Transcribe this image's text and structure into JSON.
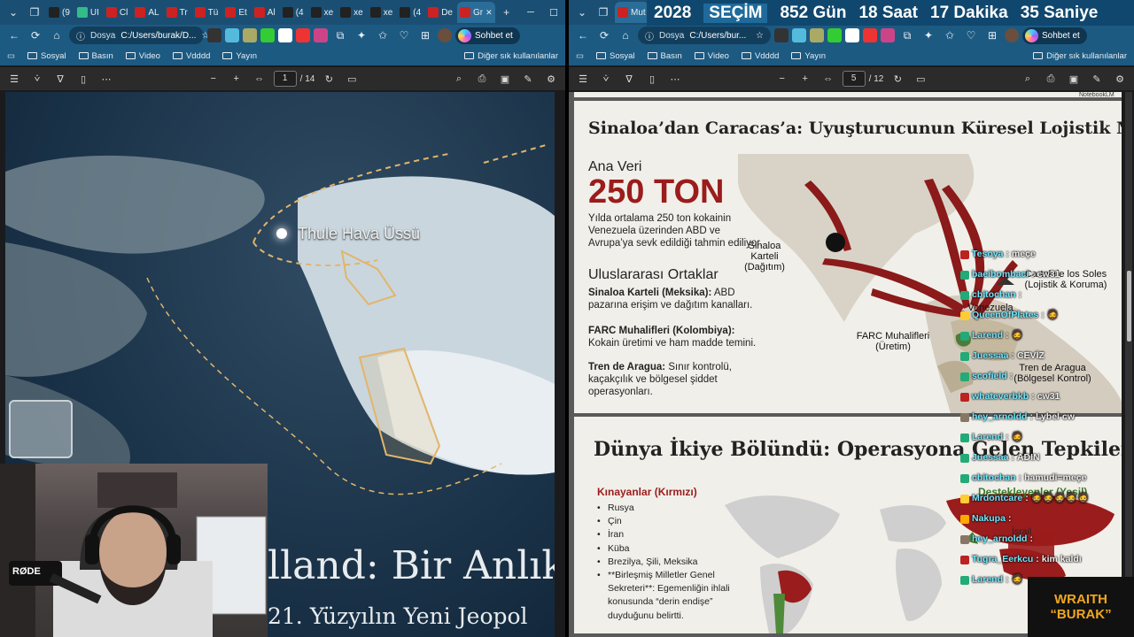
{
  "countdown": {
    "year": "2028",
    "label": "SEÇİM",
    "days": "852 Gün",
    "hours": "18 Saat",
    "minutes": "17 Dakika",
    "seconds": "35 Saniye"
  },
  "left_window": {
    "tabs": [
      "(9",
      "UI",
      "Cl",
      "AL",
      "Tr",
      "Tü",
      "Et",
      "Al",
      "(4",
      "xe",
      "xe",
      "xe",
      "(4",
      "De",
      "Gr"
    ],
    "new_tab": "+",
    "address": {
      "scheme": "Dosya",
      "path": "C:/Users/burak/D..."
    },
    "copilot_label": "Sohbet et",
    "bookmarks": [
      "Sosyal",
      "Basın",
      "Video",
      "Vdddd",
      "Yayın"
    ],
    "bookmarks_other": "Diğer sık kullanılanlar",
    "pdf": {
      "page": "1",
      "total": "/ 14"
    },
    "slide": {
      "thule_label": "Thule Hava Üssü",
      "title": "lland: Bir Anlık",
      "subtitle": "21. Yüzyılın Yeni Jeopol"
    },
    "webcam": {
      "mic_brand": "RØDE"
    }
  },
  "right_window": {
    "tabs": [
      "Mut"
    ],
    "address": {
      "scheme": "Dosya",
      "path": "C:/Users/bur..."
    },
    "copilot_label": "Sohbet et",
    "bookmarks": [
      "Sosyal",
      "Basın",
      "Video",
      "Vdddd",
      "Yayın"
    ],
    "bookmarks_other": "Diğer sık kullanılanlar",
    "pdf": {
      "page": "5",
      "total": "/ 12"
    },
    "watermark": "NotebookLM",
    "slide1": {
      "title": "Sinaloa’dan Caracas’a: Uyuşturucunun Küresel Lojistik Merkezi",
      "ana_veri": "Ana Veri",
      "ton": "250 TON",
      "desc": "Yılda ortalama 250 ton kokainin Venezuela üzerinden ABD ve Avrupa’ya sevk edildiği tahmin ediliyor.",
      "ortaklar_title": "Uluslararası Ortaklar",
      "partners": [
        {
          "name": "Sinaloa Karteli (Meksika):",
          "text": "ABD pazarına erişim ve dağıtım kanalları."
        },
        {
          "name": "FARC Muhalifleri (Kolombiya):",
          "text": "Kokain üretimi ve ham madde temini."
        },
        {
          "name": "Tren de Aragua:",
          "text": "Sınır kontrolü, kaçakçılık ve bölgesel şiddet operasyonları."
        }
      ],
      "map_labels": {
        "sinaloa": "Sinaloa Karteli",
        "sinaloa_sub": "(Dağıtım)",
        "farc": "FARC Muhalifleri",
        "farc_sub": "(Üretim)",
        "soles": "Cartel de los Soles",
        "soles_sub": "(Lojistik & Koruma)",
        "venezuela": "Venezuela",
        "tren": "Tren de Aragua",
        "tren_sub": "(Bölgesel Kontrol)"
      }
    },
    "slide2": {
      "title": "Dünya İkiye Bölündü: Operasyona Gelen Tepkiler",
      "kinayanlar": "Kınayanlar (Kırmızı)",
      "list": [
        "Rusya",
        "Çin",
        "İran",
        "Küba",
        "Brezilya, Şili, Meksika",
        "**Birleşmiş Milletler Genel Sekreteri**: Egemenliğin ihlali konusunda “derin endişe” duyduğunu belirtti."
      ],
      "destek": "Destekleyenler (Yeşil)",
      "israil": "İsrail"
    }
  },
  "chat": [
    {
      "user": "Tesoya",
      "text": "meçe",
      "badge": "#b22"
    },
    {
      "user": "baeibombaci",
      "text": "cw31",
      "badge": "#2a7"
    },
    {
      "user": "cbitochan",
      "text": "",
      "badge": "#2a7"
    },
    {
      "user": "QueenOfPlates",
      "text": "🧔",
      "badge": "#fc3"
    },
    {
      "user": "Larend",
      "text": "🧔",
      "badge": "#2a7"
    },
    {
      "user": "Juessaa",
      "text": "CEVİZ",
      "badge": "#2a7"
    },
    {
      "user": "scofield",
      "text": "",
      "badge": "#2a7"
    },
    {
      "user": "whateverbkb",
      "text": "cw31",
      "badge": "#b22"
    },
    {
      "user": "hey_arnoldd",
      "text": "Lybel cw",
      "badge": "#876"
    },
    {
      "user": "Larend",
      "text": "🧔",
      "badge": "#2a7"
    },
    {
      "user": "Juessaa",
      "text": "ADIN",
      "badge": "#2a7"
    },
    {
      "user": "cbitochan",
      "text": "hamudi=meçe",
      "badge": "#2a7"
    },
    {
      "user": "Mrdontcare",
      "text": "🧔🧔🧔🧔🧔",
      "badge": "#fc3"
    },
    {
      "user": "Nakupa",
      "text": "",
      "badge": "#fa0"
    },
    {
      "user": "hey_arnoldd",
      "text": "",
      "badge": "#876"
    },
    {
      "user": "Tugra_Eerkcu",
      "text": "kim kaldı",
      "badge": "#b22"
    },
    {
      "user": "Larend",
      "text": "🧔",
      "badge": "#2a7"
    }
  ],
  "sponsor": {
    "line1": "WRAITH",
    "line2": "“BURAK”"
  }
}
